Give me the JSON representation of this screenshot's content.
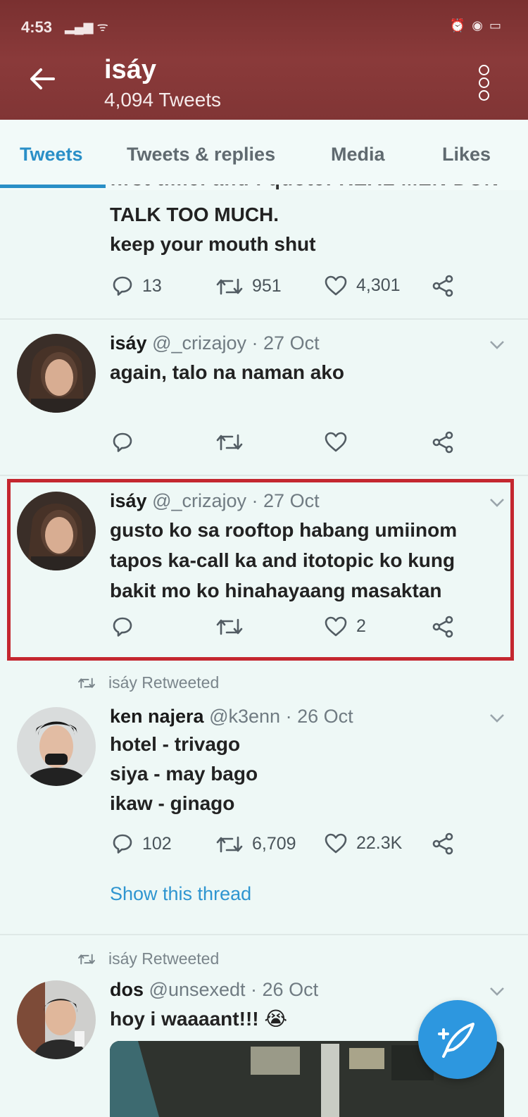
{
  "status_bar": {
    "time": "4:53",
    "signal": "▂▄▆ ᯤ",
    "right_icons": "⏰ ◉ ▭"
  },
  "header": {
    "title": "isáy",
    "subtitle": "4,094 Tweets"
  },
  "tabs": [
    {
      "label": "Tweets",
      "active": true
    },
    {
      "label": "Tweets & replies"
    },
    {
      "label": "Media"
    },
    {
      "label": "Likes"
    }
  ],
  "tweets": [
    {
      "cut_line": "first time. and i quote: REAL MEN DON'T",
      "lines": [
        "TALK TOO MUCH.",
        "keep your mouth shut"
      ],
      "reply_count": "13",
      "retweet_count": "951",
      "like_count": "4,301"
    },
    {
      "name": "isáy",
      "handle": "@_crizajoy",
      "date": "· 27 Oct",
      "lines": [
        "again, talo na naman ako"
      ],
      "reply_count": "",
      "retweet_count": "",
      "like_count": ""
    },
    {
      "name": "isáy",
      "handle": "@_crizajoy",
      "date": "· 27 Oct",
      "lines": [
        "gusto ko sa rooftop habang umiinom",
        "tapos ka-call ka and itotopic ko kung",
        "bakit mo ko hinahayaang masaktan"
      ],
      "reply_count": "",
      "retweet_count": "",
      "like_count": "2",
      "highlighted": true
    },
    {
      "retweeted_by": "isáy Retweeted",
      "name": "ken najera",
      "handle": "@k3enn",
      "date": "· 26 Oct",
      "lines": [
        "hotel - trivago",
        "siya - may bago",
        "ikaw - ginago"
      ],
      "reply_count": "102",
      "retweet_count": "6,709",
      "like_count": "22.3K",
      "thread_link": "Show this thread"
    },
    {
      "retweeted_by": "isáy Retweeted",
      "name": "dos",
      "handle": "@unsexedt",
      "date": "· 26 Oct",
      "lines": [
        "hoy i waaaant!!! 😭"
      ]
    }
  ],
  "colors": {
    "header": "#813535",
    "accent": "#2a8fc7",
    "highlight": "#c4272f",
    "background": "#eef8f6"
  },
  "icons": [
    "back-arrow-icon",
    "more-vertical-icon",
    "reply-icon",
    "retweet-icon",
    "like-icon",
    "share-icon",
    "chevron-down-icon",
    "compose-icon"
  ]
}
